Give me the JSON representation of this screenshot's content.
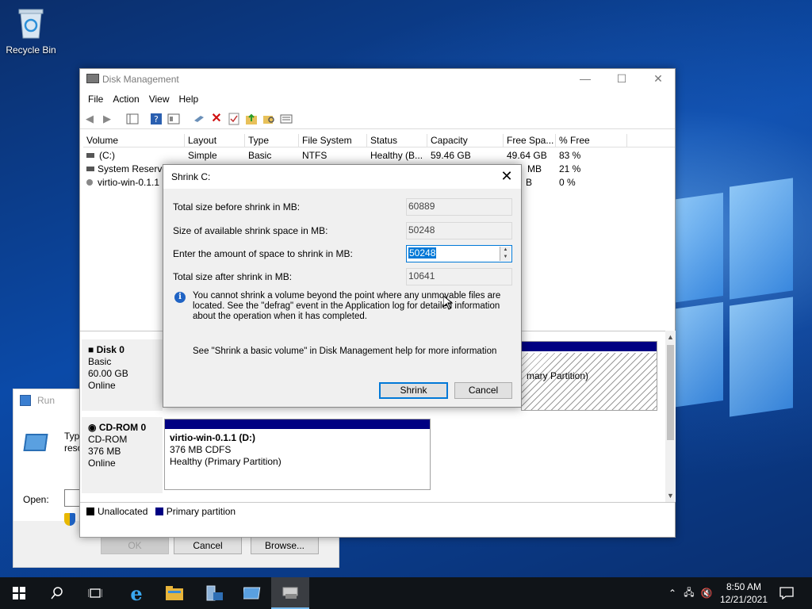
{
  "desktop": {
    "recycle_bin_label": "Recycle Bin"
  },
  "run_dialog": {
    "title": "Run",
    "description_line1": "Typ",
    "description_line2": "reso",
    "open_label": "Open:",
    "ok_label": "OK",
    "cancel_label": "Cancel",
    "browse_label": "Browse..."
  },
  "disk_mgmt": {
    "title": "Disk Management",
    "window_controls": {
      "minimize": "—",
      "maximize": "☐",
      "close": "✕"
    },
    "menu": [
      "File",
      "Action",
      "View",
      "Help"
    ],
    "columns": [
      "Volume",
      "Layout",
      "Type",
      "File System",
      "Status",
      "Capacity",
      "Free Spa...",
      "% Free"
    ],
    "volumes": [
      {
        "volume": "(C:)",
        "layout": "Simple",
        "type": "Basic",
        "fs": "NTFS",
        "status": "Healthy (B...",
        "capacity": "59.46 GB",
        "free": "49.64 GB",
        "pct": "83 %"
      },
      {
        "volume": "System Reserved",
        "free": "MB",
        "pct": "21 %"
      },
      {
        "volume": "virtio-win-0.1.1",
        "free": "B",
        "pct": "0 %"
      }
    ],
    "disks": [
      {
        "name": "Disk 0",
        "kind": "Basic",
        "size": "60.00 GB",
        "state": "Online",
        "partition_status": "mary Partition)"
      },
      {
        "name": "CD-ROM 0",
        "kind": "CD-ROM",
        "size": "376 MB",
        "state": "Online",
        "partition_name": "virtio-win-0.1.1  (D:)",
        "partition_size": "376 MB CDFS",
        "partition_status": "Healthy (Primary Partition)"
      }
    ],
    "legend": {
      "unallocated": "Unallocated",
      "primary": "Primary partition"
    },
    "colors": {
      "primary": "#000082",
      "unallocated": "#000000"
    }
  },
  "shrink_dialog": {
    "title": "Shrink C:",
    "close": "✕",
    "total_before_label": "Total size before shrink in MB:",
    "total_before_value": "60889",
    "available_label": "Size of available shrink space in MB:",
    "available_value": "50248",
    "amount_label": "Enter the amount of space to shrink in MB:",
    "amount_value": "50248",
    "total_after_label": "Total size after shrink in MB:",
    "total_after_value": "10641",
    "info_text": "You cannot shrink a volume beyond the point where any unmovable files are located. See the \"defrag\" event in the Application log for detailed information about the operation when it has completed.",
    "help_text": "See \"Shrink a basic volume\" in Disk Management help for more information",
    "shrink_label": "Shrink",
    "cancel_label": "Cancel"
  },
  "taskbar": {
    "time": "8:50 AM",
    "date": "12/21/2021"
  }
}
